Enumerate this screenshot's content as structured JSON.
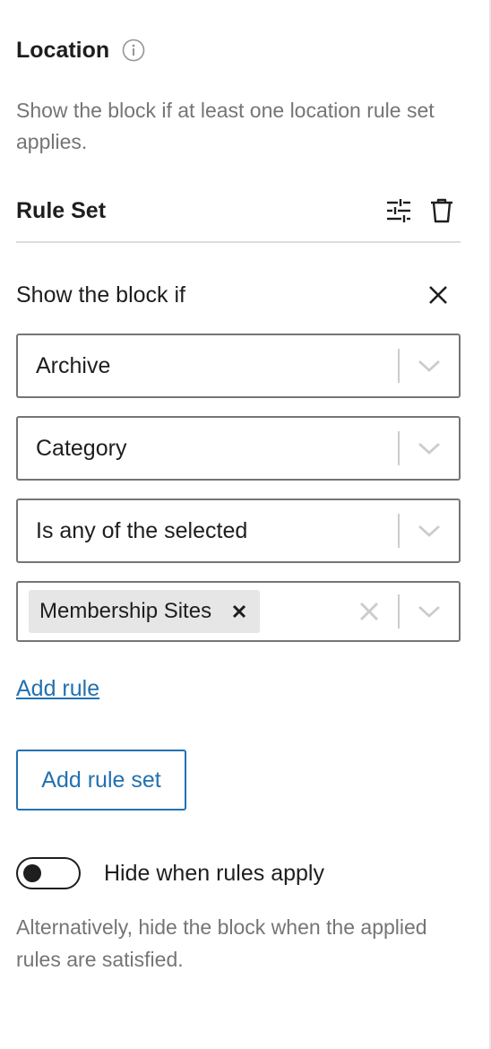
{
  "location": {
    "title": "Location",
    "description": "Show the block if at least one location rule set applies."
  },
  "rule_set": {
    "label": "Rule Set",
    "show_if_label": "Show the block if",
    "selects": [
      {
        "value": "Archive"
      },
      {
        "value": "Category"
      },
      {
        "value": "Is any of the selected"
      }
    ],
    "chips": [
      {
        "label": "Membership Sites"
      }
    ]
  },
  "actions": {
    "add_rule": "Add rule",
    "add_rule_set": "Add rule set"
  },
  "hide_toggle": {
    "label": "Hide when rules apply",
    "checked": false,
    "help": "Alternatively, hide the block when the applied rules are satisfied."
  },
  "colors": {
    "link_blue": "#2271b1",
    "muted_text": "#757575",
    "text": "#1e1e1e"
  },
  "icons": {
    "info": "info-icon",
    "settings": "sliders-icon",
    "delete": "trash-icon",
    "close": "close-icon",
    "chevron": "chevron-down-icon"
  }
}
